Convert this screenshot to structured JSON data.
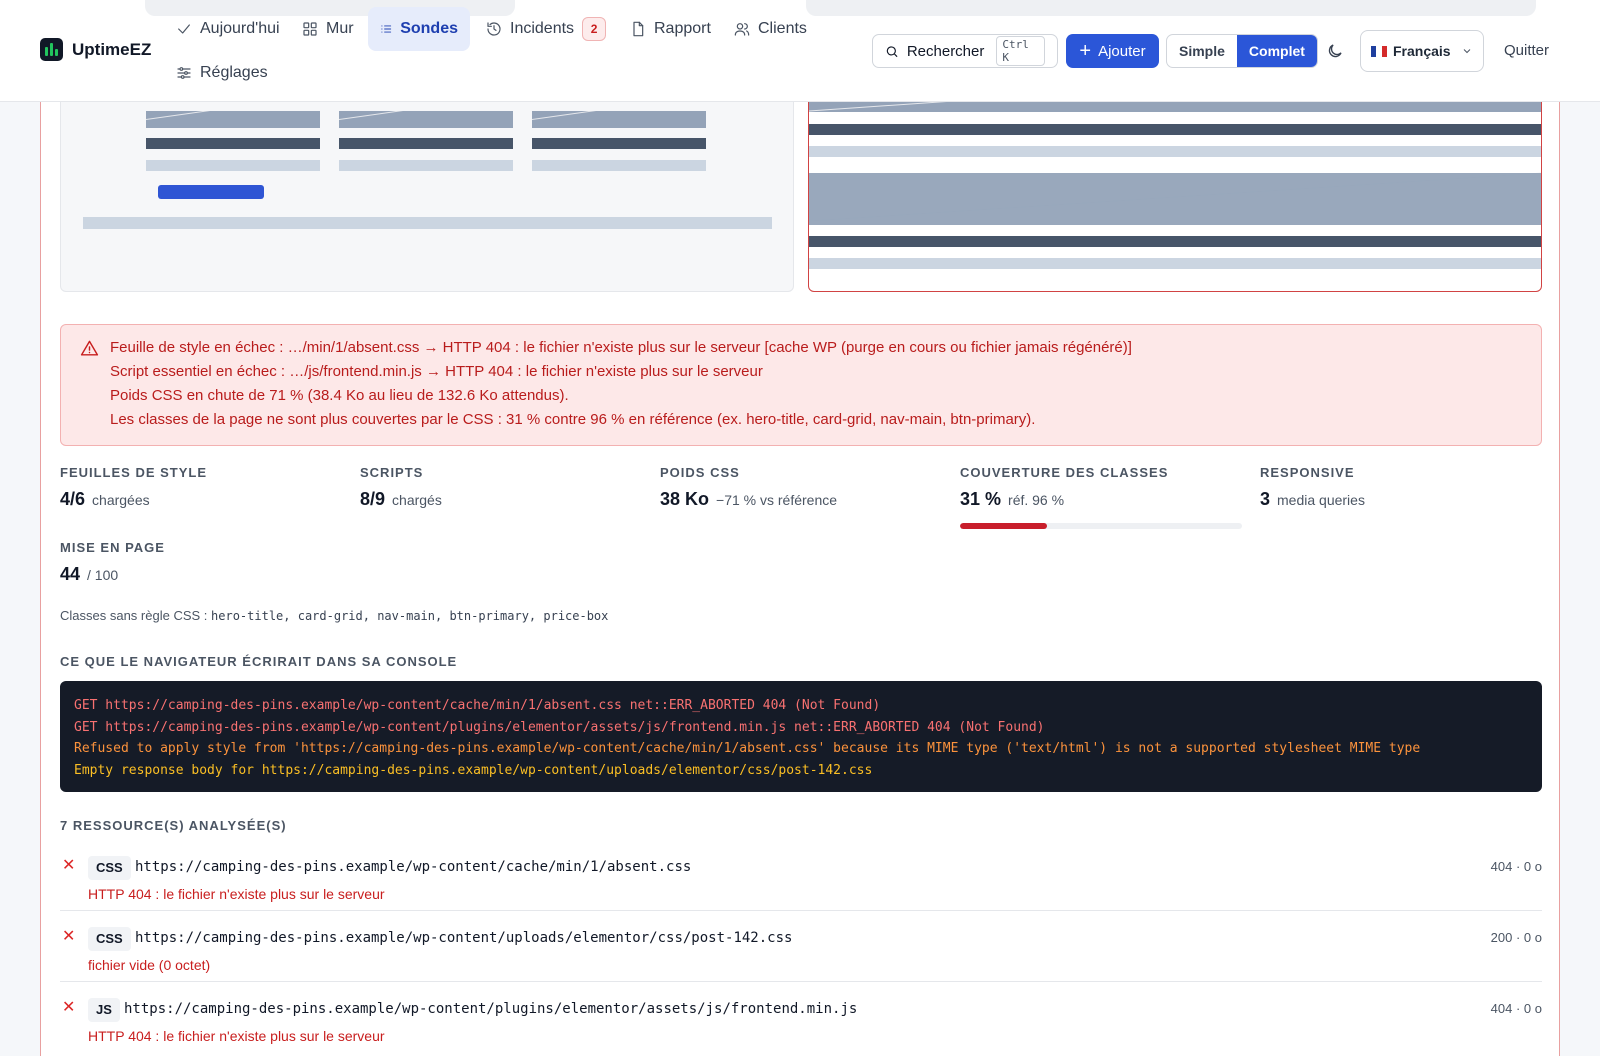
{
  "header": {
    "brand": "UptimeEZ",
    "nav": [
      {
        "id": "today",
        "label": "Aujourd'hui"
      },
      {
        "id": "wall",
        "label": "Mur"
      },
      {
        "id": "probes",
        "label": "Sondes",
        "active": true
      },
      {
        "id": "incidents",
        "label": "Incidents",
        "badge": "2"
      },
      {
        "id": "report",
        "label": "Rapport"
      },
      {
        "id": "clients",
        "label": "Clients"
      },
      {
        "id": "settings",
        "label": "Réglages"
      }
    ],
    "search_label": "Rechercher",
    "search_shortcut": "Ctrl K",
    "add_label": "Ajouter",
    "view_simple": "Simple",
    "view_full": "Complet",
    "language": "Français",
    "quit": "Quitter"
  },
  "alert": {
    "icon": "warning-icon",
    "lines": [
      "Feuille de style en échec : …/min/1/absent.css → HTTP 404 : le fichier n'existe plus sur le serveur [cache WP (purge en cours ou fichier jamais régénéré)]",
      "Script essentiel en échec : …/js/frontend.min.js → HTTP 404 : le fichier n'existe plus sur le serveur",
      "Poids CSS en chute de 71 % (38.4 Ko au lieu de 132.6 Ko attendus).",
      "Les classes de la page ne sont plus couvertes par le CSS : 31 % contre 96 % en référence (ex. hero-title, card-grid, nav-main, btn-primary)."
    ]
  },
  "stats": {
    "stylesheets": {
      "label": "FEUILLES DE STYLE",
      "value": "4/6",
      "suffix": "chargées"
    },
    "scripts": {
      "label": "SCRIPTS",
      "value": "8/9",
      "suffix": "chargés"
    },
    "css_weight": {
      "label": "POIDS CSS",
      "value": "38 Ko",
      "suffix": "−71 % vs référence"
    },
    "coverage": {
      "label": "COUVERTURE DES CLASSES",
      "value": "31 %",
      "suffix": "réf. 96 %",
      "fraction": 0.31
    },
    "responsive": {
      "label": "RESPONSIVE",
      "value": "3",
      "suffix": "media queries"
    },
    "layout": {
      "label": "MISE EN PAGE",
      "value": "44",
      "suffix": "/ 100"
    }
  },
  "orphans": {
    "label": "Classes sans règle CSS :",
    "classes": "hero-title, card-grid, nav-main, btn-primary, price-box"
  },
  "console": {
    "title": "CE QUE LE NAVIGATEUR ÉCRIRAIT DANS SA CONSOLE",
    "lines": [
      "GET https://camping-des-pins.example/wp-content/cache/min/1/absent.css net::ERR_ABORTED 404 (Not Found)",
      "GET https://camping-des-pins.example/wp-content/plugins/elementor/assets/js/frontend.min.js net::ERR_ABORTED 404 (Not Found)",
      "Refused to apply style from 'https://camping-des-pins.example/wp-content/cache/min/1/absent.css' because its MIME type ('text/html') is not a supported stylesheet MIME type",
      "Empty response body for https://camping-des-pins.example/wp-content/uploads/elementor/css/post-142.css"
    ]
  },
  "resources": {
    "title": "7 RESSOURCE(S) ANALYSÉE(S)",
    "items": [
      {
        "type": "CSS",
        "url": "https://camping-des-pins.example/wp-content/cache/min/1/absent.css",
        "meta": "404 · 0 o",
        "error": "HTTP 404 : le fichier n'existe plus sur le serveur"
      },
      {
        "type": "CSS",
        "url": "https://camping-des-pins.example/wp-content/uploads/elementor/css/post-142.css",
        "meta": "200 · 0 o",
        "error": "fichier vide (0 octet)"
      },
      {
        "type": "JS",
        "url": "https://camping-des-pins.example/wp-content/plugins/elementor/assets/js/frontend.min.js",
        "meta": "404 · 0 o",
        "error": "HTTP 404 : le fichier n'existe plus sur le serveur"
      }
    ]
  },
  "colors": {
    "accent": "#2b56d8",
    "error": "#c81e1e",
    "alert_bg": "#fde8e8",
    "console_bg": "#151b27"
  }
}
